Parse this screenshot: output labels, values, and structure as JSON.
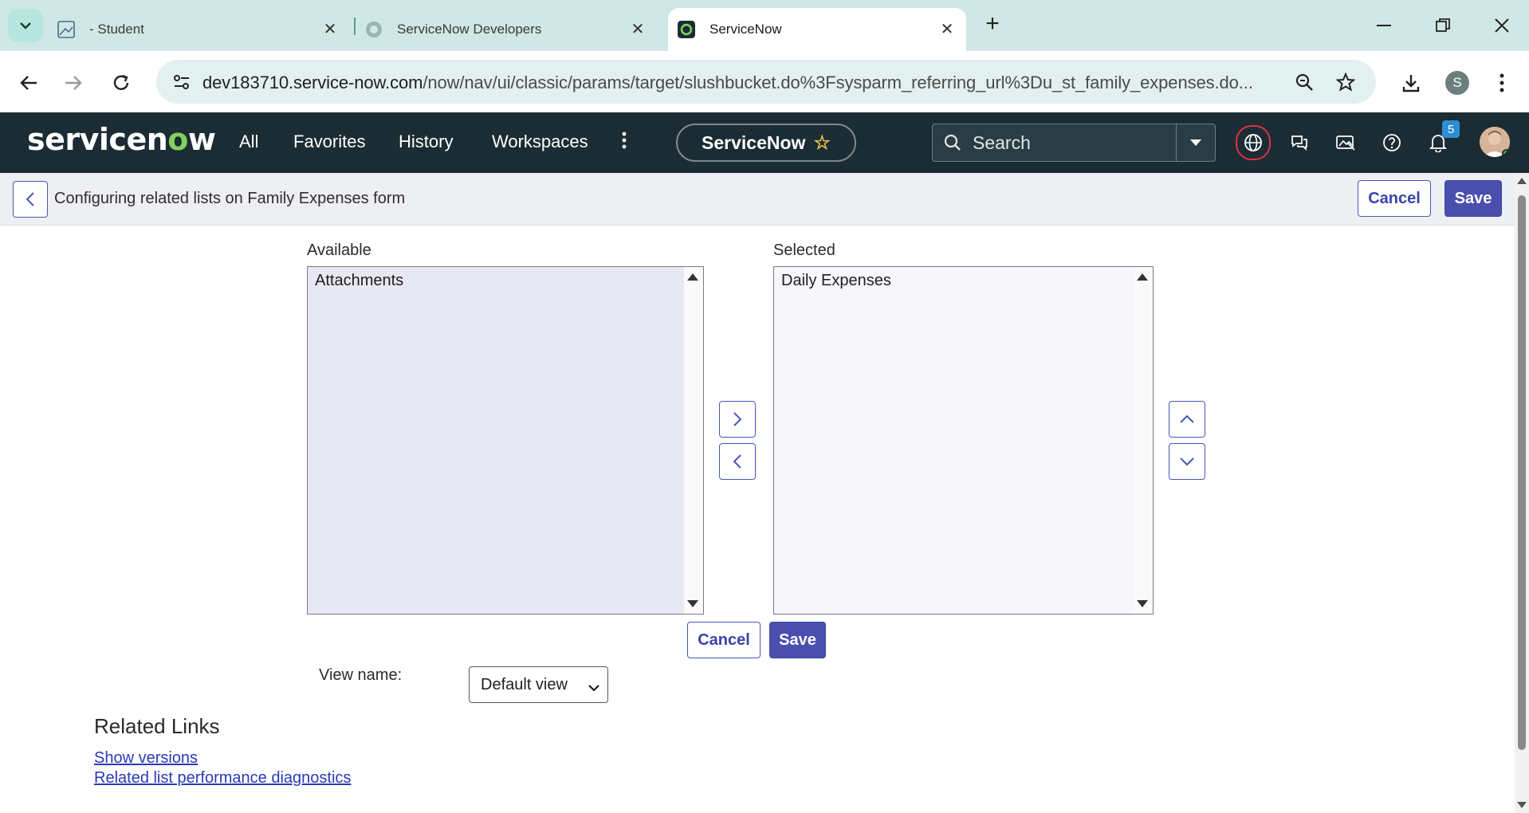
{
  "browser": {
    "tabs": [
      {
        "title": "- Student",
        "active": false
      },
      {
        "title": "ServiceNow Developers",
        "active": false
      },
      {
        "title": "ServiceNow",
        "active": true
      }
    ],
    "url_host": "dev183710.service-now.com",
    "url_path": "/now/nav/ui/classic/params/target/slushbucket.do%3Fsysparm_referring_url%3Du_st_family_expenses.do...",
    "profile_initial": "S"
  },
  "header": {
    "logo_pre": "servicen",
    "logo_o": "o",
    "logo_post": "w",
    "nav": [
      "All",
      "Favorites",
      "History",
      "Workspaces"
    ],
    "instance_name": "ServiceNow",
    "search_placeholder": "Search",
    "notification_count": "5"
  },
  "titlebar": {
    "title": "Configuring related lists on Family Expenses form",
    "cancel_label": "Cancel",
    "save_label": "Save"
  },
  "slushbucket": {
    "available_label": "Available",
    "available_items": [
      "Attachments"
    ],
    "selected_label": "Selected",
    "selected_items": [
      "Daily Expenses"
    ],
    "cancel_label": "Cancel",
    "save_label": "Save"
  },
  "view": {
    "label": "View name:",
    "selected": "Default view"
  },
  "related_links": {
    "heading": "Related Links",
    "links": [
      "Show versions",
      "Related list performance diagnostics"
    ]
  },
  "colors": {
    "header_bg": "#1b2c34",
    "primary": "#4a4fae",
    "logo_accent": "#81d15c",
    "tabbar_bg": "#cfe8e6"
  }
}
